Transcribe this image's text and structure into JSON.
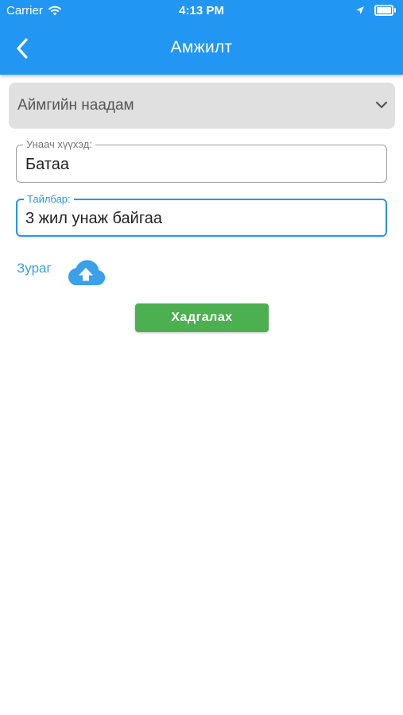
{
  "status_bar": {
    "carrier": "Carrier",
    "time": "4:13 PM"
  },
  "header": {
    "title": "Амжилт",
    "back_icon": "chevron-left-icon"
  },
  "dropdown": {
    "selected": "Аймгийн наадам"
  },
  "fields": {
    "rider": {
      "label": "Унаач хүүхэд:",
      "value": "Батаа"
    },
    "description": {
      "label": "Тайлбар:",
      "value": "3 жил унаж байгаа"
    }
  },
  "photo": {
    "label": "Зураг",
    "icon": "cloud-upload-icon"
  },
  "save_button": {
    "label": "Хадгалах"
  },
  "colors": {
    "primary": "#2196F3",
    "save": "#4CAF50",
    "link": "#3aa0e8"
  }
}
